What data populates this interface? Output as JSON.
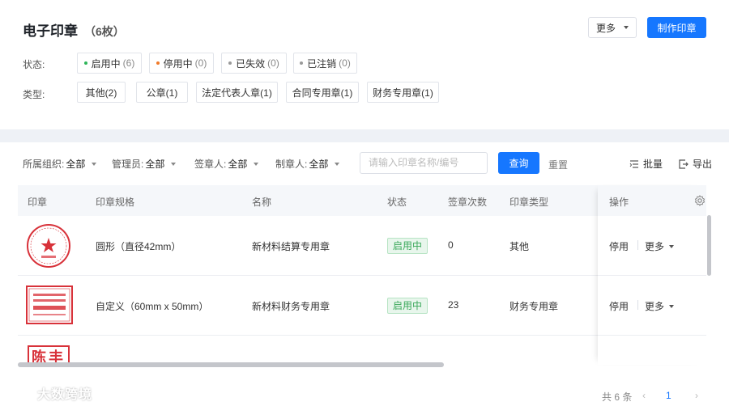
{
  "header": {
    "title": "电子印章",
    "count": "（6枚）",
    "more_label": "更多",
    "make_label": "制作印章"
  },
  "filters": {
    "status_label": "状态:",
    "status": [
      {
        "label": "启用中",
        "num": "(6)",
        "color": "#2fb55a"
      },
      {
        "label": "停用中",
        "num": "(0)",
        "color": "#f07a2a"
      },
      {
        "label": "已失效",
        "num": "(0)",
        "color": "#999999"
      },
      {
        "label": "已注销",
        "num": "(0)",
        "color": "#999999"
      }
    ],
    "type_label": "类型:",
    "types": [
      "其他(2)",
      "公章(1)",
      "法定代表人章(1)",
      "合同专用章(1)",
      "财务专用章(1)"
    ]
  },
  "toolbar": {
    "org_label": "所属组织:",
    "org_value": "全部",
    "admin_label": "管理员:",
    "admin_value": "全部",
    "signer_label": "签章人:",
    "signer_value": "全部",
    "maker_label": "制章人:",
    "maker_value": "全部",
    "search_placeholder": "请输入印章名称/编号",
    "query_label": "查询",
    "reset_label": "重置",
    "batch_label": "批量",
    "export_label": "导出"
  },
  "table": {
    "columns": [
      "印章",
      "印章规格",
      "名称",
      "状态",
      "签章次数",
      "印章类型",
      "操作"
    ],
    "rows": [
      {
        "spec": "圆形（直径42mm）",
        "name": "新材料结算专用章",
        "status": "启用中",
        "times": "0",
        "type": "其他",
        "op1": "停用",
        "op2": "更多"
      },
      {
        "spec": "自定义（60mm x 50mm）",
        "name": "新材料财务专用章",
        "status": "启用中",
        "times": "23",
        "type": "财务专用章",
        "op1": "停用",
        "op2": "更多"
      }
    ],
    "partial_stamp_text": "陈丰"
  },
  "pagination": {
    "total": "共 6 条",
    "page": "1"
  },
  "watermark": "大数跨境",
  "colors": {
    "primary": "#1677ff",
    "active_tag": "#3aa85a",
    "stamp_red": "#d8323a"
  }
}
